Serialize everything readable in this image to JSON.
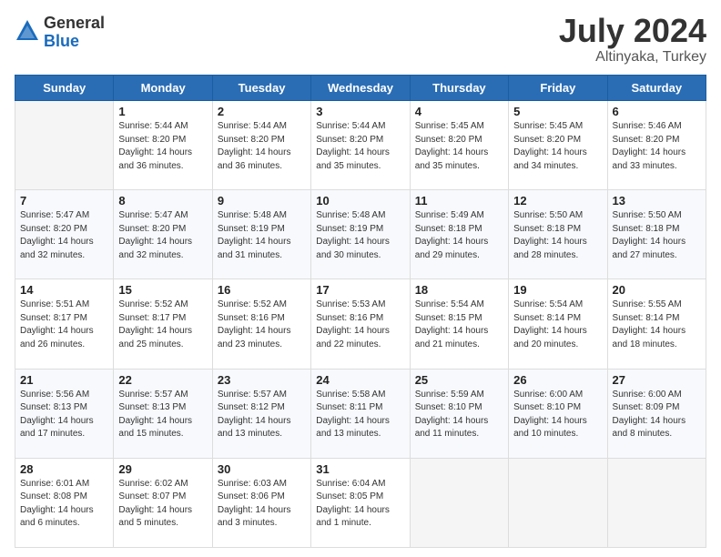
{
  "logo": {
    "general": "General",
    "blue": "Blue"
  },
  "title": {
    "month": "July 2024",
    "location": "Altinyaka, Turkey"
  },
  "weekdays": [
    "Sunday",
    "Monday",
    "Tuesday",
    "Wednesday",
    "Thursday",
    "Friday",
    "Saturday"
  ],
  "weeks": [
    [
      {
        "day": "",
        "info": ""
      },
      {
        "day": "1",
        "info": "Sunrise: 5:44 AM\nSunset: 8:20 PM\nDaylight: 14 hours\nand 36 minutes."
      },
      {
        "day": "2",
        "info": "Sunrise: 5:44 AM\nSunset: 8:20 PM\nDaylight: 14 hours\nand 36 minutes."
      },
      {
        "day": "3",
        "info": "Sunrise: 5:44 AM\nSunset: 8:20 PM\nDaylight: 14 hours\nand 35 minutes."
      },
      {
        "day": "4",
        "info": "Sunrise: 5:45 AM\nSunset: 8:20 PM\nDaylight: 14 hours\nand 35 minutes."
      },
      {
        "day": "5",
        "info": "Sunrise: 5:45 AM\nSunset: 8:20 PM\nDaylight: 14 hours\nand 34 minutes."
      },
      {
        "day": "6",
        "info": "Sunrise: 5:46 AM\nSunset: 8:20 PM\nDaylight: 14 hours\nand 33 minutes."
      }
    ],
    [
      {
        "day": "7",
        "info": "Sunrise: 5:47 AM\nSunset: 8:20 PM\nDaylight: 14 hours\nand 32 minutes."
      },
      {
        "day": "8",
        "info": "Sunrise: 5:47 AM\nSunset: 8:20 PM\nDaylight: 14 hours\nand 32 minutes."
      },
      {
        "day": "9",
        "info": "Sunrise: 5:48 AM\nSunset: 8:19 PM\nDaylight: 14 hours\nand 31 minutes."
      },
      {
        "day": "10",
        "info": "Sunrise: 5:48 AM\nSunset: 8:19 PM\nDaylight: 14 hours\nand 30 minutes."
      },
      {
        "day": "11",
        "info": "Sunrise: 5:49 AM\nSunset: 8:18 PM\nDaylight: 14 hours\nand 29 minutes."
      },
      {
        "day": "12",
        "info": "Sunrise: 5:50 AM\nSunset: 8:18 PM\nDaylight: 14 hours\nand 28 minutes."
      },
      {
        "day": "13",
        "info": "Sunrise: 5:50 AM\nSunset: 8:18 PM\nDaylight: 14 hours\nand 27 minutes."
      }
    ],
    [
      {
        "day": "14",
        "info": "Sunrise: 5:51 AM\nSunset: 8:17 PM\nDaylight: 14 hours\nand 26 minutes."
      },
      {
        "day": "15",
        "info": "Sunrise: 5:52 AM\nSunset: 8:17 PM\nDaylight: 14 hours\nand 25 minutes."
      },
      {
        "day": "16",
        "info": "Sunrise: 5:52 AM\nSunset: 8:16 PM\nDaylight: 14 hours\nand 23 minutes."
      },
      {
        "day": "17",
        "info": "Sunrise: 5:53 AM\nSunset: 8:16 PM\nDaylight: 14 hours\nand 22 minutes."
      },
      {
        "day": "18",
        "info": "Sunrise: 5:54 AM\nSunset: 8:15 PM\nDaylight: 14 hours\nand 21 minutes."
      },
      {
        "day": "19",
        "info": "Sunrise: 5:54 AM\nSunset: 8:14 PM\nDaylight: 14 hours\nand 20 minutes."
      },
      {
        "day": "20",
        "info": "Sunrise: 5:55 AM\nSunset: 8:14 PM\nDaylight: 14 hours\nand 18 minutes."
      }
    ],
    [
      {
        "day": "21",
        "info": "Sunrise: 5:56 AM\nSunset: 8:13 PM\nDaylight: 14 hours\nand 17 minutes."
      },
      {
        "day": "22",
        "info": "Sunrise: 5:57 AM\nSunset: 8:13 PM\nDaylight: 14 hours\nand 15 minutes."
      },
      {
        "day": "23",
        "info": "Sunrise: 5:57 AM\nSunset: 8:12 PM\nDaylight: 14 hours\nand 13 minutes."
      },
      {
        "day": "24",
        "info": "Sunrise: 5:58 AM\nSunset: 8:11 PM\nDaylight: 14 hours\nand 13 minutes."
      },
      {
        "day": "25",
        "info": "Sunrise: 5:59 AM\nSunset: 8:10 PM\nDaylight: 14 hours\nand 11 minutes."
      },
      {
        "day": "26",
        "info": "Sunrise: 6:00 AM\nSunset: 8:10 PM\nDaylight: 14 hours\nand 10 minutes."
      },
      {
        "day": "27",
        "info": "Sunrise: 6:00 AM\nSunset: 8:09 PM\nDaylight: 14 hours\nand 8 minutes."
      }
    ],
    [
      {
        "day": "28",
        "info": "Sunrise: 6:01 AM\nSunset: 8:08 PM\nDaylight: 14 hours\nand 6 minutes."
      },
      {
        "day": "29",
        "info": "Sunrise: 6:02 AM\nSunset: 8:07 PM\nDaylight: 14 hours\nand 5 minutes."
      },
      {
        "day": "30",
        "info": "Sunrise: 6:03 AM\nSunset: 8:06 PM\nDaylight: 14 hours\nand 3 minutes."
      },
      {
        "day": "31",
        "info": "Sunrise: 6:04 AM\nSunset: 8:05 PM\nDaylight: 14 hours\nand 1 minute."
      },
      {
        "day": "",
        "info": ""
      },
      {
        "day": "",
        "info": ""
      },
      {
        "day": "",
        "info": ""
      }
    ]
  ]
}
